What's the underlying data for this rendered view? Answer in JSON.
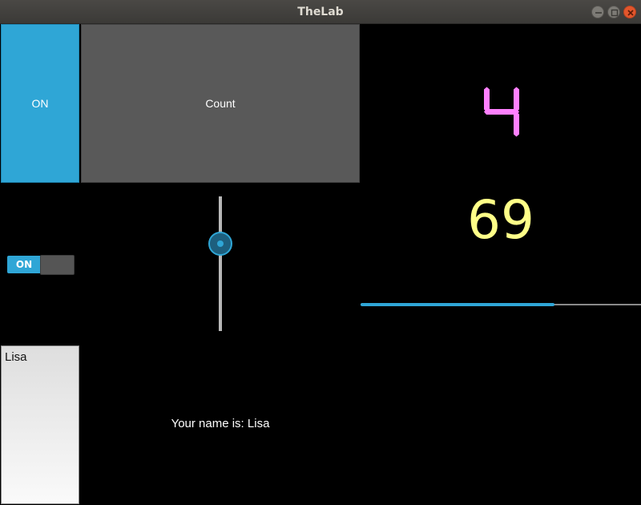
{
  "window": {
    "title": "TheLab"
  },
  "buttons": {
    "toggle_label": "ON",
    "count_label": "Count"
  },
  "digit_display": {
    "value": "4",
    "color": "#ff80ff"
  },
  "number_label": {
    "value": "69",
    "color": "#ffff88"
  },
  "progress": {
    "value_percent": 69,
    "color": "#2fa6d6"
  },
  "switch": {
    "state_label": "ON",
    "accent": "#2fa6d6"
  },
  "slider": {
    "value_fraction": 0.69,
    "orientation": "vertical"
  },
  "name_input": {
    "value": "Lisa"
  },
  "greeting": {
    "text": "Your name is: Lisa"
  }
}
